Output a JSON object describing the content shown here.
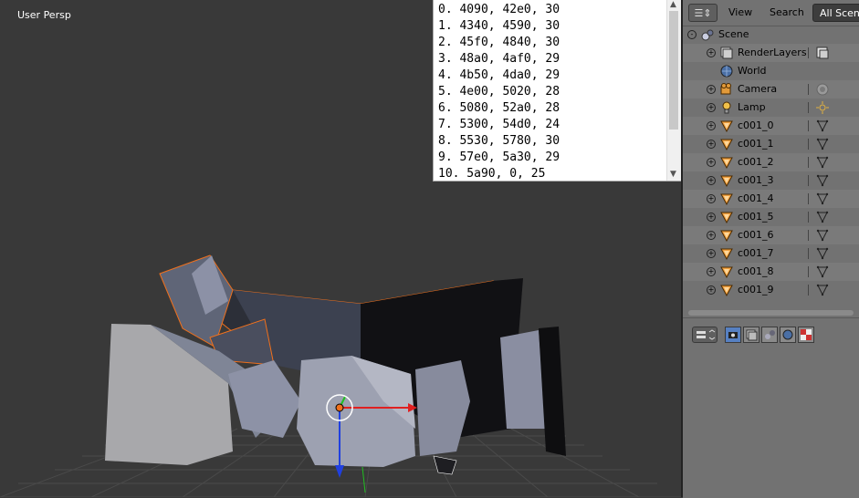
{
  "viewport": {
    "view_label": "User Persp",
    "accent_select": "#f0701c"
  },
  "text_panel": {
    "lines": [
      "0. 4090, 42e0, 30",
      "1. 4340, 4590, 30",
      "2. 45f0, 4840, 30",
      "3. 48a0, 4af0, 29",
      "4. 4b50, 4da0, 29",
      "5. 4e00, 5020, 28",
      "6. 5080, 52a0, 28",
      "7. 5300, 54d0, 24",
      "8. 5530, 5780, 30",
      "9. 57e0, 5a30, 29",
      "10. 5a90, 0, 25"
    ]
  },
  "outliner": {
    "header": {
      "editor_icon": "outliner-icon",
      "view_label": "View",
      "search_label": "Search",
      "filter_label": "All Scenes"
    },
    "tree": [
      {
        "label": "Scene",
        "icon": "scene-icon",
        "expand": "-",
        "indent": 0
      },
      {
        "label": "RenderLayers",
        "icon": "renderlayers-icon",
        "expand": "+",
        "indent": 1,
        "extra": "renderlayer-toggle-icon"
      },
      {
        "label": "World",
        "icon": "world-icon",
        "expand": "",
        "indent": 1
      },
      {
        "label": "Camera",
        "icon": "camera-object-icon",
        "expand": "+",
        "indent": 1,
        "extra": "camera-data-icon"
      },
      {
        "label": "Lamp",
        "icon": "lamp-object-icon",
        "expand": "+",
        "indent": 1,
        "extra": "lamp-data-icon"
      },
      {
        "label": "c001_0",
        "icon": "mesh-object-icon",
        "expand": "+",
        "indent": 1,
        "extra": "mesh-data-icon"
      },
      {
        "label": "c001_1",
        "icon": "mesh-object-icon",
        "expand": "+",
        "indent": 1,
        "extra": "mesh-data-icon"
      },
      {
        "label": "c001_2",
        "icon": "mesh-object-icon",
        "expand": "+",
        "indent": 1,
        "extra": "mesh-data-icon"
      },
      {
        "label": "c001_3",
        "icon": "mesh-object-icon",
        "expand": "+",
        "indent": 1,
        "extra": "mesh-data-icon"
      },
      {
        "label": "c001_4",
        "icon": "mesh-object-icon",
        "expand": "+",
        "indent": 1,
        "extra": "mesh-data-icon"
      },
      {
        "label": "c001_5",
        "icon": "mesh-object-icon",
        "expand": "+",
        "indent": 1,
        "extra": "mesh-data-icon"
      },
      {
        "label": "c001_6",
        "icon": "mesh-object-icon",
        "expand": "+",
        "indent": 1,
        "extra": "mesh-data-icon"
      },
      {
        "label": "c001_7",
        "icon": "mesh-object-icon",
        "expand": "+",
        "indent": 1,
        "extra": "mesh-data-icon"
      },
      {
        "label": "c001_8",
        "icon": "mesh-object-icon",
        "expand": "+",
        "indent": 1,
        "extra": "mesh-data-icon"
      },
      {
        "label": "c001_9",
        "icon": "mesh-object-icon",
        "expand": "+",
        "indent": 1,
        "extra": "mesh-data-icon"
      }
    ]
  },
  "properties": {
    "editor_icon": "properties-editor-icon",
    "tabs": [
      {
        "name": "render-tab-icon",
        "active": true
      },
      {
        "name": "renderlayers-tab-icon",
        "active": false
      },
      {
        "name": "scene-tab-icon",
        "active": false
      },
      {
        "name": "world-tab-icon",
        "active": false
      },
      {
        "name": "texture-tab-icon",
        "active": false
      }
    ]
  }
}
